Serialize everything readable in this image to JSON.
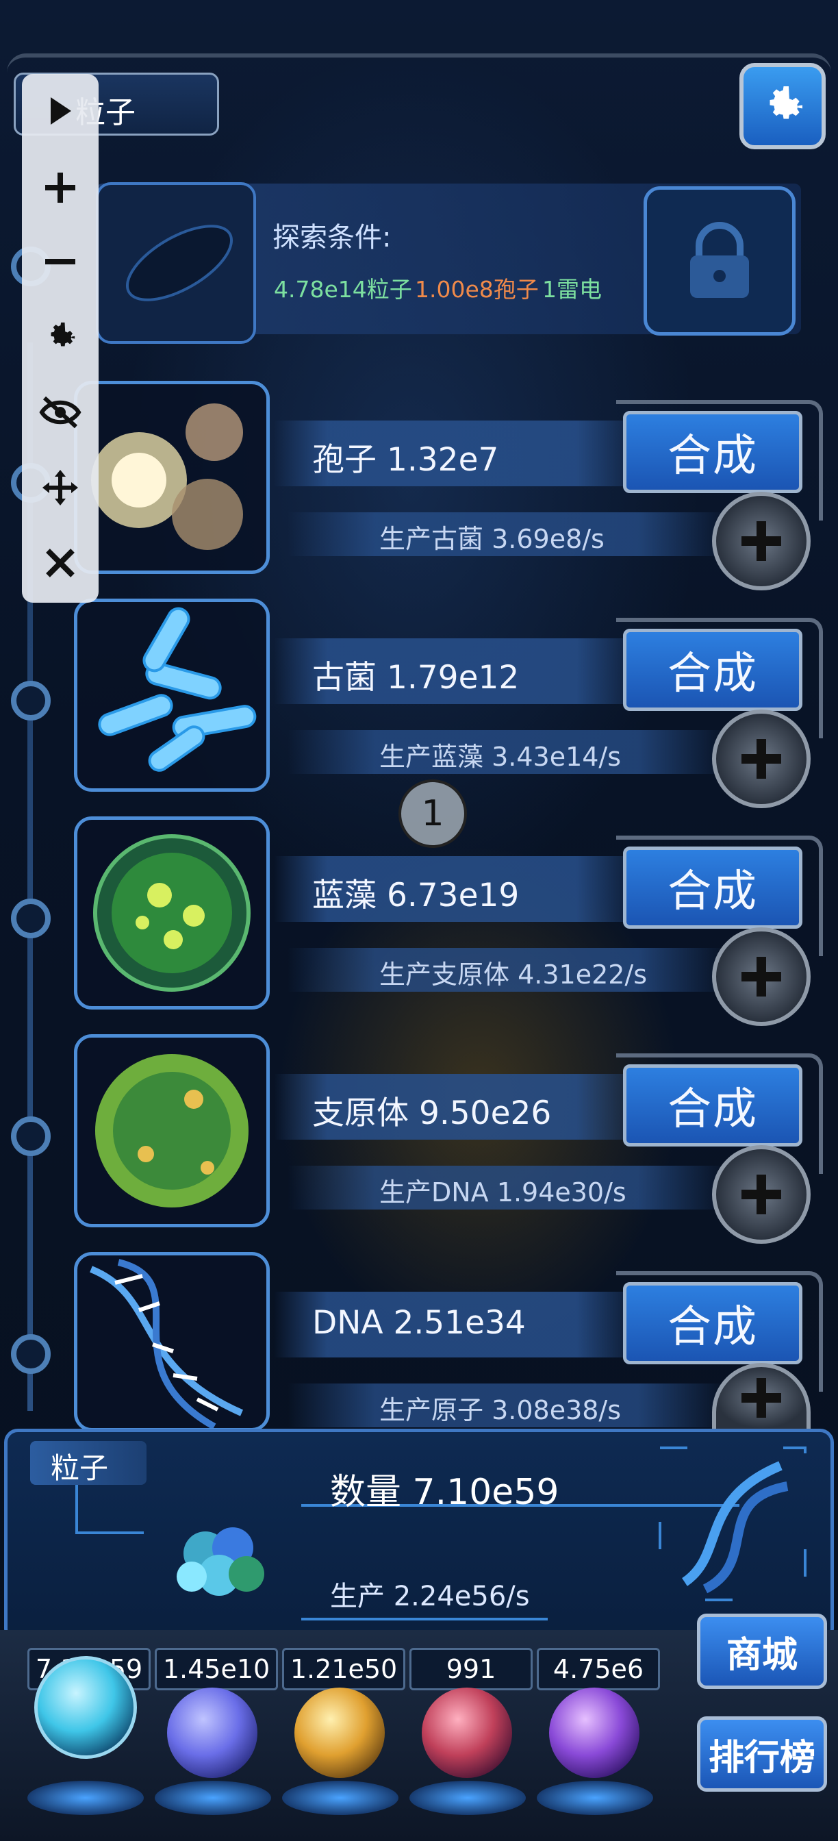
{
  "header": {
    "current_resource": "粒子",
    "settings_icon": "gear-icon"
  },
  "explore": {
    "title": "探索条件:",
    "requirements": [
      {
        "text": "4.78e14粒子",
        "color": "#7de0a0"
      },
      {
        "text": "1.00e8孢子",
        "color": "#f08a4a"
      },
      {
        "text": "1雷电",
        "color": "#7de0a0"
      }
    ],
    "locked_icon": "lock-icon"
  },
  "toolbar": {
    "items": [
      "+",
      "−",
      "⚙",
      "hide",
      "move",
      "✕"
    ]
  },
  "rows": [
    {
      "name": "孢子 1.32e7",
      "production": "生产古菌 3.69e8/s",
      "craft_label": "合成"
    },
    {
      "name": "古菌 1.79e12",
      "production": "生产蓝藻 3.43e14/s",
      "craft_label": "合成"
    },
    {
      "name": "蓝藻 6.73e19",
      "production": "生产支原体 4.31e22/s",
      "craft_label": "合成"
    },
    {
      "name": "支原体 9.50e26",
      "production": "生产DNA 1.94e30/s",
      "craft_label": "合成"
    },
    {
      "name": "DNA 2.51e34",
      "production": "生产原子 3.08e38/s",
      "craft_label": "合成"
    }
  ],
  "center_marker": "1",
  "summary": {
    "tag": "粒子",
    "count": "数量 7.10e59",
    "production": "生产 2.24e56/s"
  },
  "currencies": [
    {
      "value": "7.10e59",
      "orb_color": "#3fc6e8"
    },
    {
      "value": "1.45e10",
      "orb_color": "#6a6ee8"
    },
    {
      "value": "1.21e50",
      "orb_color": "#e0a030"
    },
    {
      "value": "991",
      "orb_color": "#c0405a"
    },
    {
      "value": "4.75e6",
      "orb_color": "#8a4ad8"
    }
  ],
  "side_buttons": {
    "shop": "商城",
    "ranking": "排行榜"
  }
}
